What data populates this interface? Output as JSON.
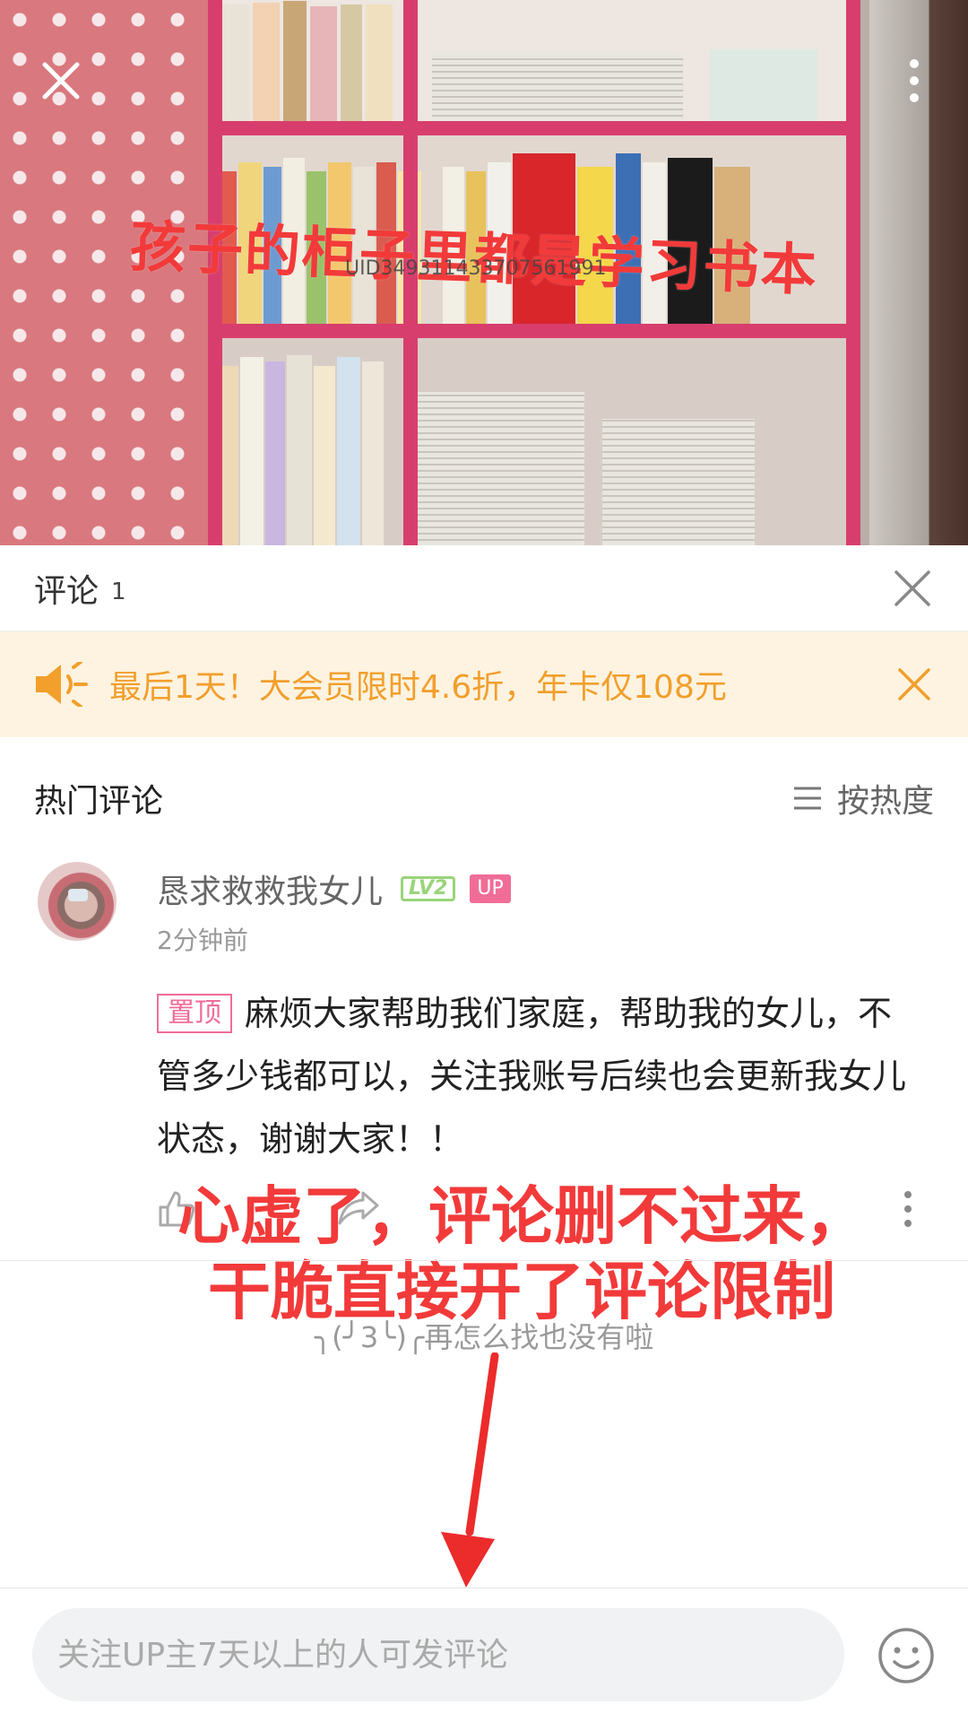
{
  "video": {
    "caption": "孩子的柜子里都是学习书本",
    "watermark": "UID349311433707561991"
  },
  "panel": {
    "title": "评论",
    "count": "1"
  },
  "promo": {
    "text": "最后1天！大会员限时4.6折，年卡仅108元"
  },
  "section": {
    "title": "热门评论",
    "sort_label": "按热度"
  },
  "comment": {
    "username": "恳求救救我女儿",
    "level": "LV2",
    "up_badge": "UP",
    "time": "2分钟前",
    "pin_tag": "置顶",
    "text": "麻烦大家帮助我们家庭，帮助我的女儿，不管多少钱都可以，关注我账号后续也会更新我女儿状态，谢谢大家！！"
  },
  "annotation": {
    "line1": "心虚了，评论删不过来，",
    "line2": "干脆直接开了评论限制"
  },
  "end_text": "╮(╯3╰)╭再怎么找也没有啦",
  "input": {
    "placeholder": "关注UP主7天以上的人可发评论"
  },
  "colors": {
    "accent_pink": "#f06d98",
    "promo_orange": "#f29f2c",
    "annotation_red": "#f23a3a"
  }
}
